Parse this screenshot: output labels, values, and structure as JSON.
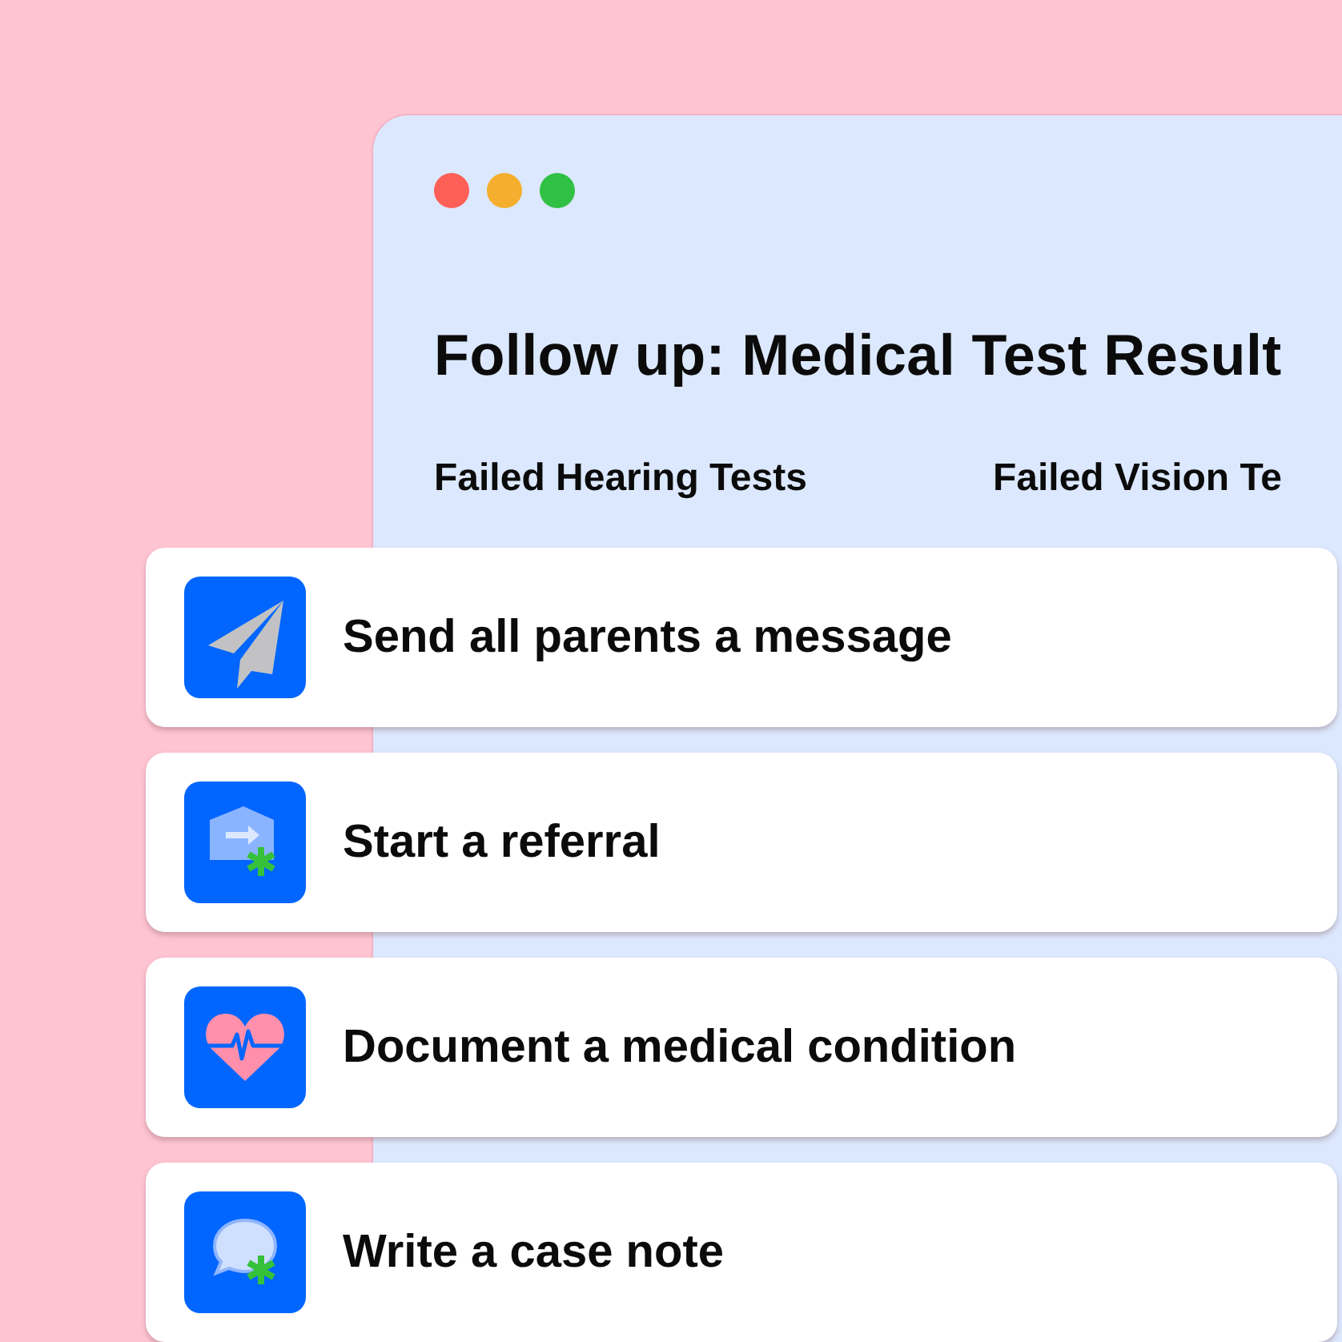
{
  "window": {
    "lights": [
      {
        "color": "#fe5f57"
      },
      {
        "color": "#f5ae2e"
      },
      {
        "color": "#30c144"
      }
    ],
    "title": "Follow up: Medical Test Result",
    "tabs": [
      {
        "label": "Failed Hearing Tests"
      },
      {
        "label": "Failed Vision Te"
      }
    ]
  },
  "actions": [
    {
      "kind": "send",
      "label": "Send all parents a message"
    },
    {
      "kind": "referral",
      "label": "Start a referral"
    },
    {
      "kind": "medical",
      "label": "Document a medical condition"
    },
    {
      "kind": "note",
      "label": "Write a case note"
    }
  ]
}
